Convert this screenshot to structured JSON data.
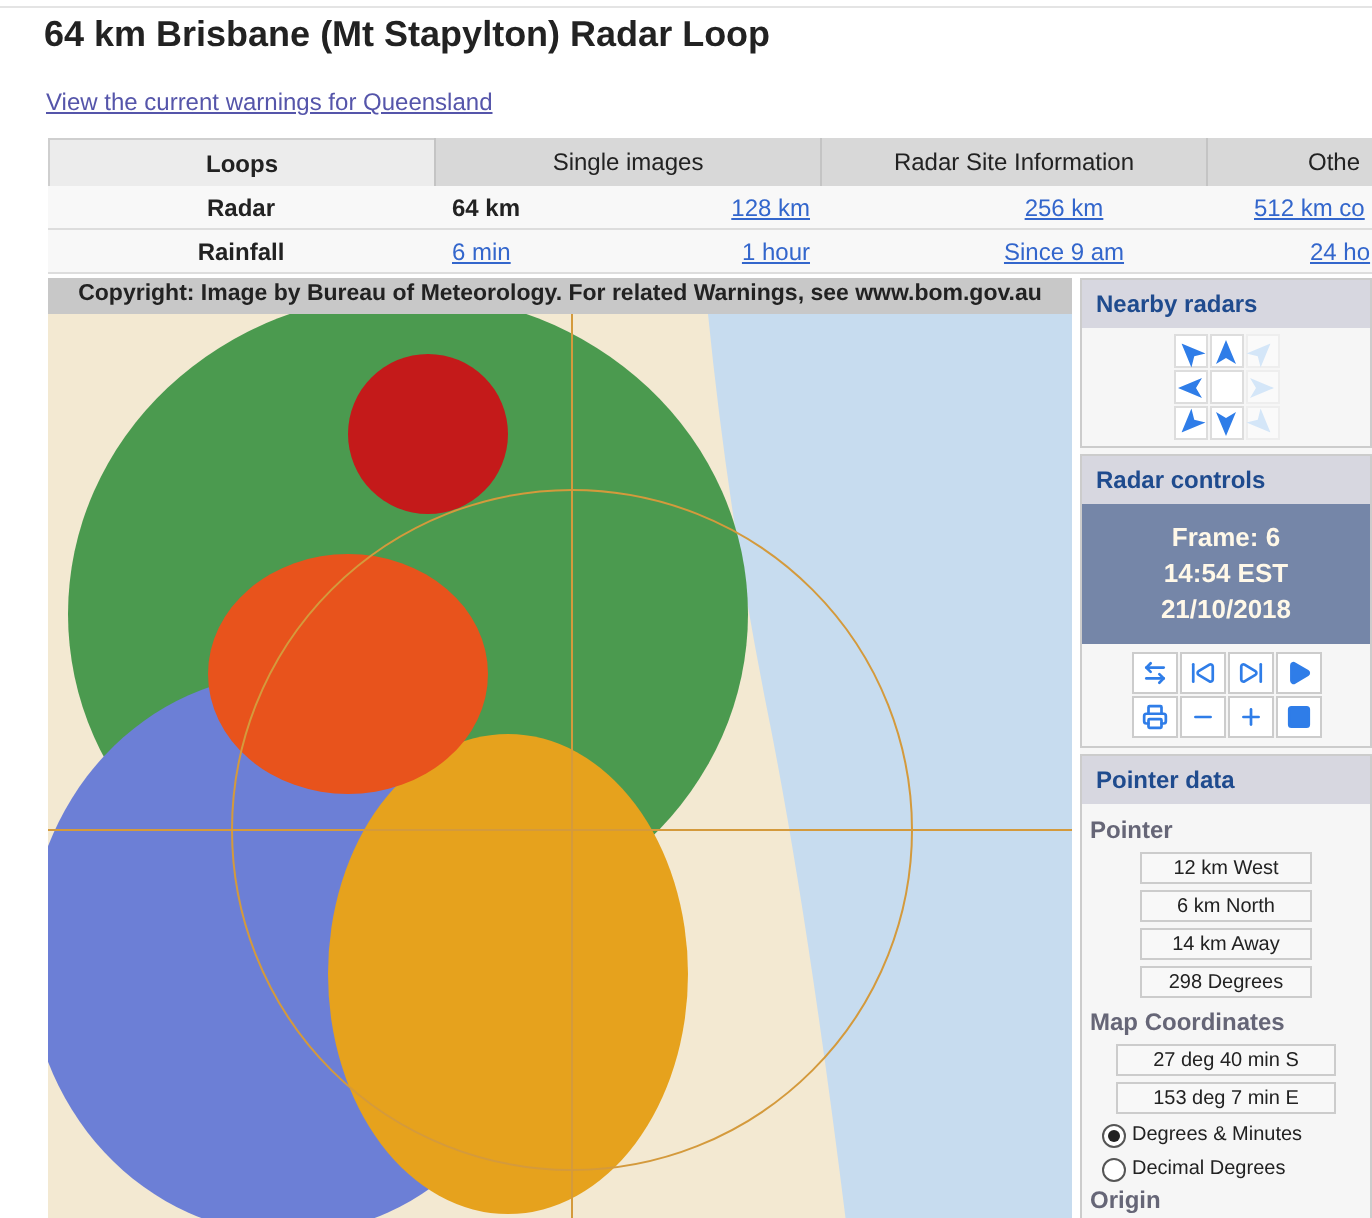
{
  "title": "64 km Brisbane (Mt Stapylton) Radar Loop",
  "warnings_link": "View the current warnings for Queensland",
  "tabs": [
    {
      "label": "Loops",
      "selected": true
    },
    {
      "label": "Single images",
      "selected": false
    },
    {
      "label": "Radar Site Information",
      "selected": false
    },
    {
      "label": "Othe",
      "selected": false
    }
  ],
  "rows": [
    {
      "label": "Radar",
      "cells": [
        {
          "text": "64 km",
          "selected": true
        },
        {
          "text": "128 km",
          "selected": false
        },
        {
          "text": "256 km",
          "selected": false
        },
        {
          "text": "512 km co",
          "selected": false
        }
      ]
    },
    {
      "label": "Rainfall",
      "cells": [
        {
          "text": "6 min",
          "selected": false
        },
        {
          "text": "1 hour",
          "selected": false
        },
        {
          "text": "Since 9 am",
          "selected": false
        },
        {
          "text": "24 ho",
          "selected": false
        }
      ]
    }
  ],
  "map": {
    "copyright": "Copyright: Image by Bureau of Meteorology. For related Warnings, see www.bom.gov.au"
  },
  "nearby_radars": {
    "title": "Nearby radars",
    "arrows": [
      {
        "kind": "nw",
        "disabled": false
      },
      {
        "kind": "n",
        "disabled": false
      },
      {
        "kind": "ne",
        "disabled": true
      },
      {
        "kind": "w",
        "disabled": false
      },
      {
        "kind": "none",
        "disabled": false
      },
      {
        "kind": "e",
        "disabled": true
      },
      {
        "kind": "sw",
        "disabled": false
      },
      {
        "kind": "s",
        "disabled": false
      },
      {
        "kind": "se",
        "disabled": true
      }
    ]
  },
  "radar_controls": {
    "title": "Radar controls",
    "frame": "Frame: 6",
    "time": "14:54 EST",
    "date": "21/10/2018",
    "buttons": [
      {
        "kind": "swap"
      },
      {
        "kind": "first"
      },
      {
        "kind": "step"
      },
      {
        "kind": "play"
      },
      {
        "kind": "print"
      },
      {
        "kind": "minus"
      },
      {
        "kind": "plus"
      },
      {
        "kind": "stop"
      }
    ]
  },
  "pointer_data": {
    "title": "Pointer data",
    "pointer_heading": "Pointer",
    "pointer": [
      "12 km West",
      "6 km North",
      "14 km Away",
      "298 Degrees"
    ],
    "coords_heading": "Map Coordinates",
    "coords": [
      "27 deg 40 min S",
      "153 deg 7 min E"
    ],
    "formats": [
      {
        "label": "Degrees & Minutes",
        "selected": true
      },
      {
        "label": "Decimal Degrees",
        "selected": false
      }
    ],
    "origin_heading": "Origin"
  }
}
